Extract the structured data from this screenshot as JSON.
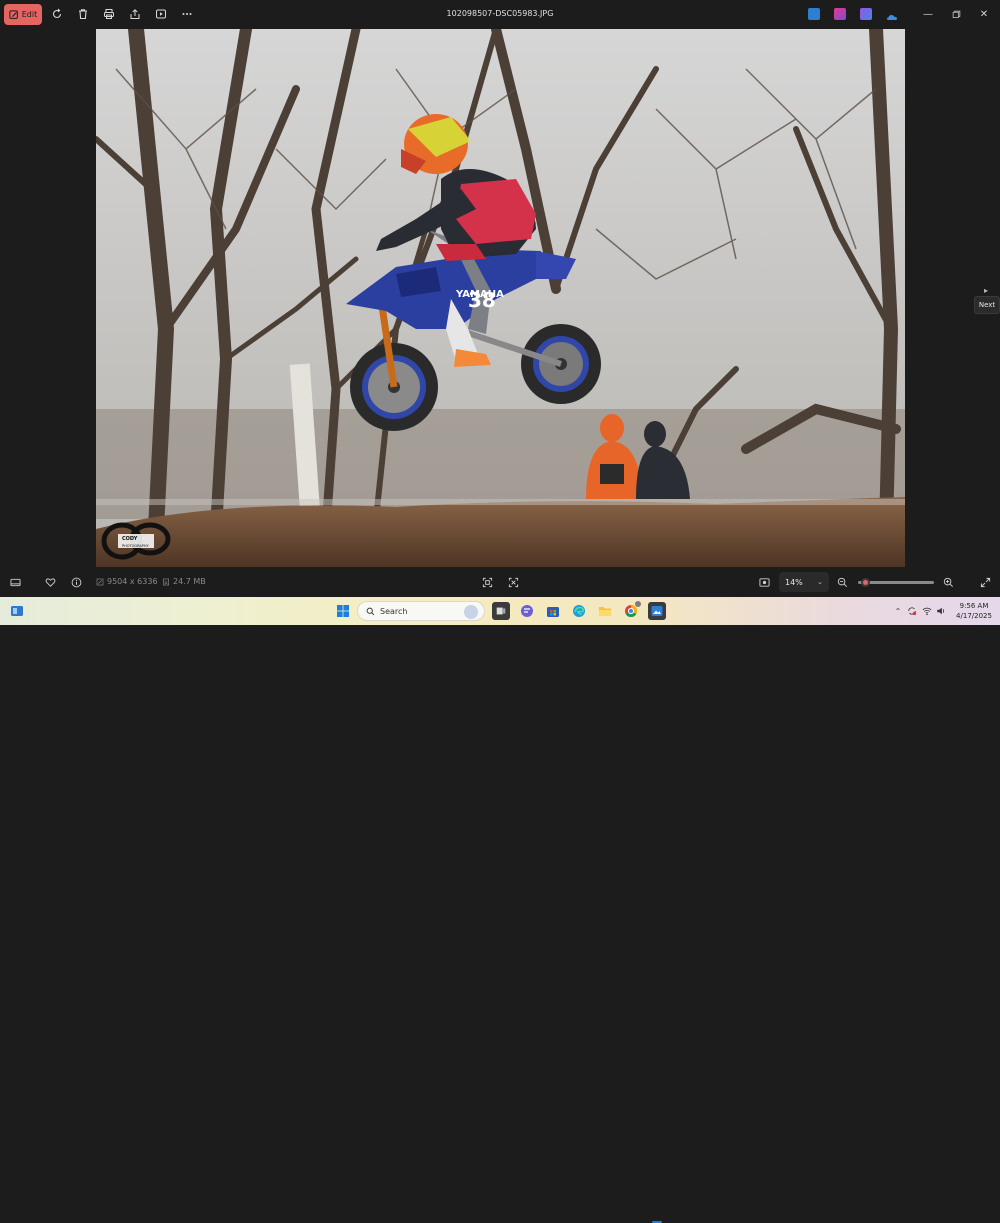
{
  "titlebar": {
    "edit_label": "Edit",
    "filename": "102098507-DSC05983.JPG"
  },
  "photo": {
    "rider_number": "38",
    "bike_brand": "YAMAHA",
    "watermark_line1": "CODY",
    "watermark_line2": "PHOTOGRAPHY"
  },
  "next_tooltip": "Next",
  "bottombar": {
    "dimensions": "9504 x 6336",
    "file_size": "24.7 MB",
    "zoom_value": "14%",
    "zoom_fraction": 0.05
  },
  "taskbar": {
    "search_placeholder": "Search",
    "time": "9:56 AM",
    "date": "4/17/2025"
  },
  "colors": {
    "accent": "#e46562",
    "background": "#1c1c1c"
  }
}
